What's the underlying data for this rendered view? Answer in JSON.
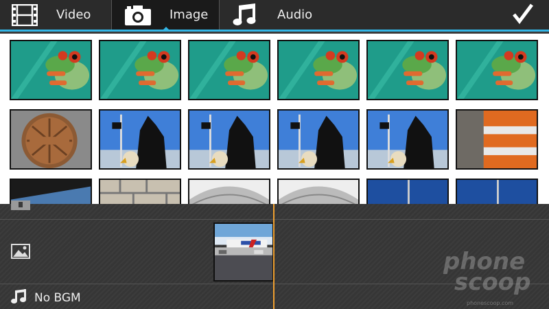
{
  "tabs": [
    {
      "label": "Video",
      "icon": "film-icon",
      "active": false
    },
    {
      "label": "Image",
      "icon": "camera-icon",
      "active": true
    },
    {
      "label": "Audio",
      "icon": "music-note-icon",
      "active": false
    }
  ],
  "confirm_icon": "checkmark-icon",
  "accent_color": "#33b5e5",
  "playhead_color": "#f0a030",
  "thumbnails": [
    {
      "subject": "frog"
    },
    {
      "subject": "frog"
    },
    {
      "subject": "frog"
    },
    {
      "subject": "frog"
    },
    {
      "subject": "frog"
    },
    {
      "subject": "frog"
    },
    {
      "subject": "manhole"
    },
    {
      "subject": "eagle-statue"
    },
    {
      "subject": "eagle-statue"
    },
    {
      "subject": "eagle-statue"
    },
    {
      "subject": "eagle-statue"
    },
    {
      "subject": "traffic-barrel"
    },
    {
      "subject": "car-window"
    },
    {
      "subject": "stone-wall"
    },
    {
      "subject": "snowy-field"
    },
    {
      "subject": "snowy-field"
    },
    {
      "subject": "sky"
    },
    {
      "subject": "sky"
    }
  ],
  "timeline": {
    "image_track_icon": "image-icon",
    "audio_track_icon": "music-note-icon",
    "bgm_label": "No BGM"
  },
  "watermark": {
    "line1": "phone",
    "line2": "scoop",
    "sub": "phonescoop.com"
  }
}
